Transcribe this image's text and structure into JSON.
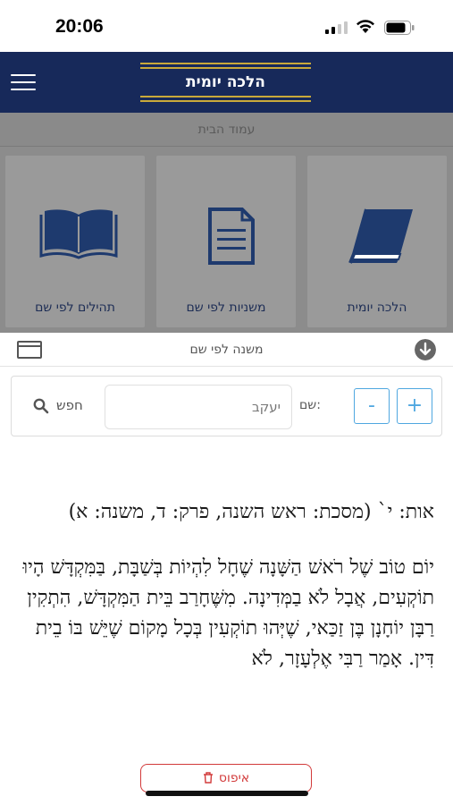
{
  "status": {
    "time": "20:06"
  },
  "header": {
    "app_title": "הלכה יומית"
  },
  "home": {
    "label": "עמוד הבית"
  },
  "tiles": [
    {
      "label": "הלכה יומית",
      "icon": "book-icon"
    },
    {
      "label": "משניות לפי שם",
      "icon": "document-icon"
    },
    {
      "label": "תהילים לפי שם",
      "icon": "open-book-icon"
    }
  ],
  "name_section": {
    "title": "משנה לפי שם"
  },
  "search": {
    "plus_label": "+",
    "minus_label": "-",
    "name_label": "שם:",
    "name_value": "יעקב",
    "search_label": "חפש"
  },
  "result": {
    "meta": "אות: י` (מסכת: ראש השנה, פרק: ד, משנה: א)",
    "text": "יוֹם טוֹב שֶׁל רֹאשׁ הַשָּׁנָה שֶׁחָל לִהְיוֹת בְּשַׁבָּת, בַּמִּקְדָּשׁ הָיוּ תוֹקְעִים, אֲבָל לֹא בַמְּדִינָה. מִשֶּׁחָרַב בֵּית הַמִּקְדָּשׁ, הִתְקִין רַבָּן יוֹחָנָן בֶּן זַכַּאי, שֶׁיְּהוּ תוֹקְעִין בְּכָל מָקוֹם שֶׁיֵּשׁ בּוֹ בֵית דִּין. אָמַר רַבִּי אֶלְעָזָר, לֹא"
  },
  "reset": {
    "label": "איפוס"
  },
  "colors": {
    "navy": "#17295a",
    "gold": "#c9a93a",
    "accent": "#4fa7e0",
    "danger": "#d23a3a"
  }
}
